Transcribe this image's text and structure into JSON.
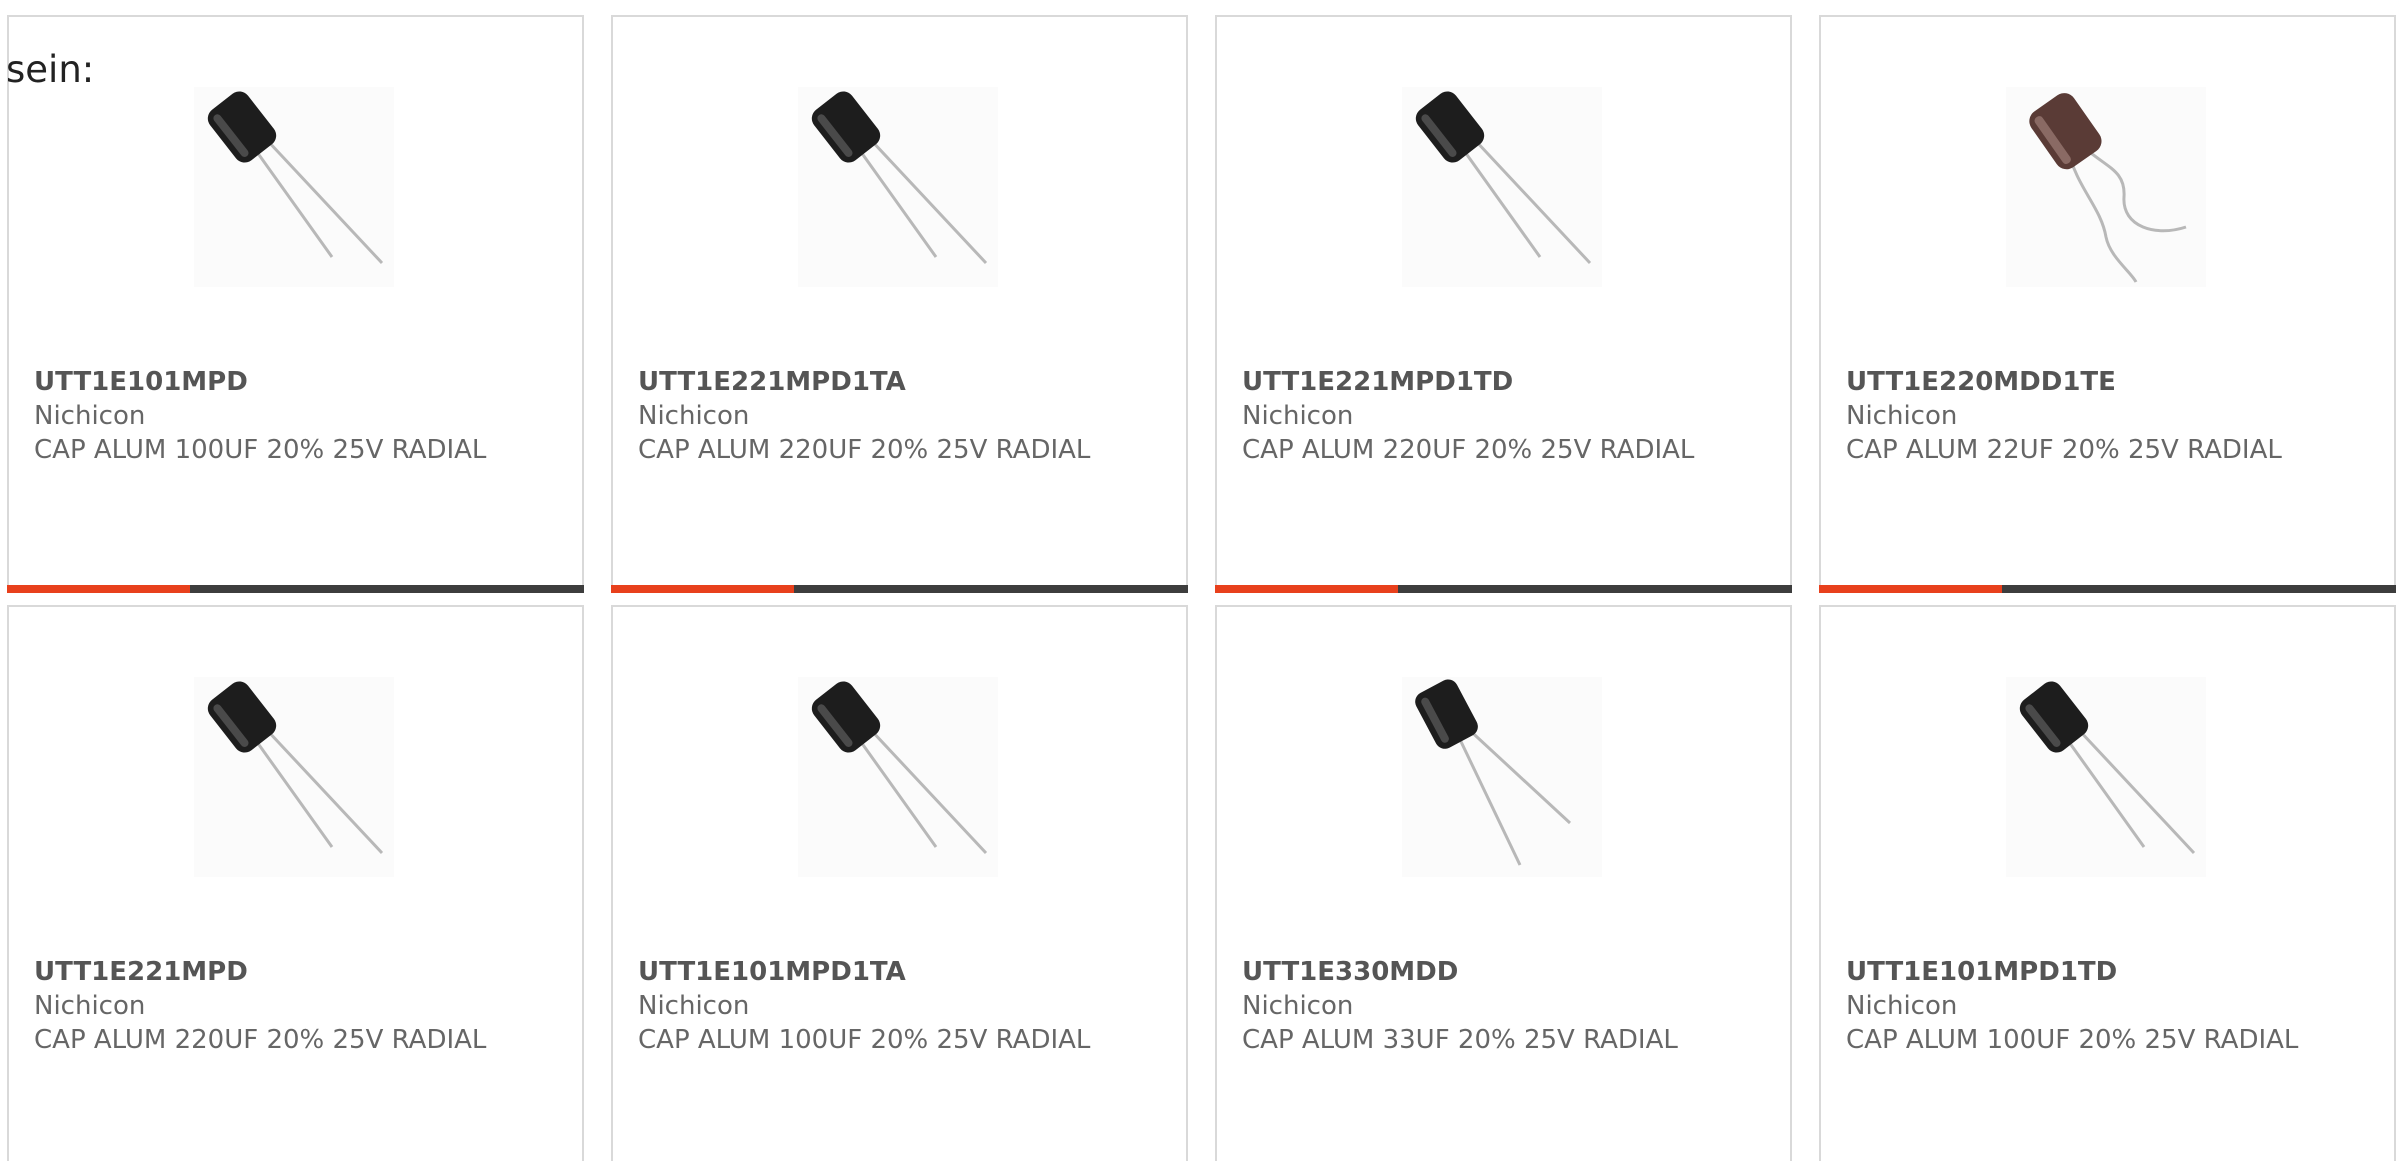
{
  "intro_text": "sein:",
  "colors": {
    "accent": "#e8401c",
    "bar": "#3d3d3d",
    "border": "#d9d9d9",
    "text": "#666666"
  },
  "products": [
    {
      "part_number": "UTT1E101MPD",
      "manufacturer": "Nichicon",
      "description": "CAP ALUM 100UF 20% 25V RADIAL",
      "image": "capacitor-photo",
      "accent_bar": true
    },
    {
      "part_number": "UTT1E221MPD1TA",
      "manufacturer": "Nichicon",
      "description": "CAP ALUM 220UF 20% 25V RADIAL",
      "image": "capacitor-photo",
      "accent_bar": true
    },
    {
      "part_number": "UTT1E221MPD1TD",
      "manufacturer": "Nichicon",
      "description": "CAP ALUM 220UF 20% 25V RADIAL",
      "image": "capacitor-photo",
      "accent_bar": true
    },
    {
      "part_number": "UTT1E220MDD1TE",
      "manufacturer": "Nichicon",
      "description": "CAP ALUM 22UF 20% 25V RADIAL",
      "image": "capacitor-photo-brown",
      "accent_bar": true
    },
    {
      "part_number": "UTT1E221MPD",
      "manufacturer": "Nichicon",
      "description": "CAP ALUM 220UF 20% 25V RADIAL",
      "image": "capacitor-photo",
      "accent_bar": false
    },
    {
      "part_number": "UTT1E101MPD1TA",
      "manufacturer": "Nichicon",
      "description": "CAP ALUM 100UF 20% 25V RADIAL",
      "image": "capacitor-photo",
      "accent_bar": false
    },
    {
      "part_number": "UTT1E330MDD",
      "manufacturer": "Nichicon",
      "description": "CAP ALUM 33UF 20% 25V RADIAL",
      "image": "capacitor-photo-upright",
      "accent_bar": false
    },
    {
      "part_number": "UTT1E101MPD1TD",
      "manufacturer": "Nichicon",
      "description": "CAP ALUM 100UF 20% 25V RADIAL",
      "image": "capacitor-photo",
      "accent_bar": false
    }
  ]
}
